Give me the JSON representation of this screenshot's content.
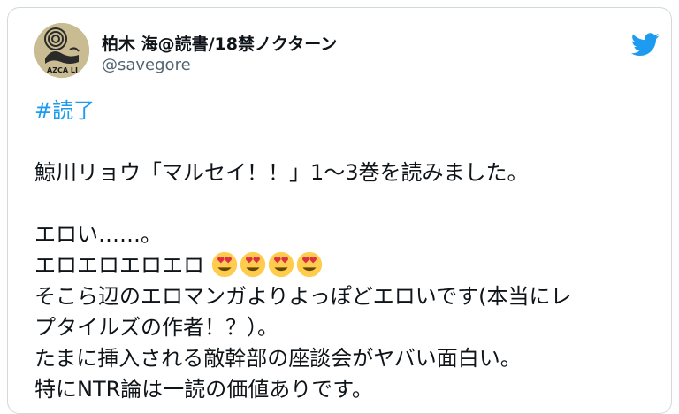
{
  "user": {
    "display_name": "柏木 海@読書/18禁ノクターン",
    "handle": "@savegore",
    "avatar_icon": "avatar-image",
    "avatar_text": "AZCA LI"
  },
  "brand": {
    "icon": "twitter-bird-icon",
    "color": "#1d9bf0"
  },
  "tweet": {
    "hashtag": "#読了",
    "line1": "鯨川リョウ「マルセイ！！」1〜3巻を読みました。",
    "line2": "エロい……。",
    "line3_text": "エロエロエロエロ",
    "line3_emoji_icon": "smiling-face-with-heart-eyes-icon",
    "line4": "そこら辺のエロマンガよりよっぽどエロいです(本当にレ",
    "line5": "プタイルズの作者！？）。",
    "line6": "たまに挿入される敵幹部の座談会がヤバい面白い。",
    "line7": "特にNTR論は一読の価値ありです。"
  }
}
